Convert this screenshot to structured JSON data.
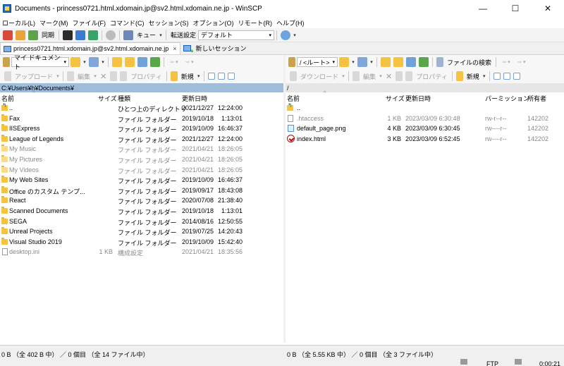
{
  "window": {
    "title": "Documents - princess0721.html.xdomain.jp@sv2.html.xdomain.ne.jp - WinSCP",
    "min_glyph": "—",
    "max_glyph": "☐",
    "close_glyph": "✕"
  },
  "menu": [
    "ローカル(L)",
    "マーク(M)",
    "ファイル(F)",
    "コマンド(C)",
    "セッション(S)",
    "オプション(O)",
    "リモート(R)",
    "ヘルプ(H)"
  ],
  "toolbar": {
    "sync_label": "同期",
    "queue_label": "キュー",
    "transfer_label": "転送設定",
    "transfer_value": "デフォルト"
  },
  "tabs": {
    "session_tab": "princess0721.html.xdomain.jp@sv2.html.xdomain.ne.jp",
    "close_glyph": "×",
    "new_session": "新しいセッション"
  },
  "left": {
    "location": "マイ ドキュメント",
    "upload": "アップロード",
    "edit": "編集",
    "properties": "プロパティ",
    "new": "新規",
    "path": "C:¥Users¥h¥Documents¥",
    "columns": {
      "name": "名前",
      "size": "サイズ",
      "type": "種類",
      "modified": "更新日時"
    },
    "rows": [
      {
        "name": "..",
        "size": "",
        "type": "ひとつ上のディレクトリ",
        "modified": "2021/12/27",
        "time": "12:24:00",
        "icon": "up",
        "grey": false
      },
      {
        "name": "Fax",
        "size": "",
        "type": "ファイル フォルダー",
        "modified": "2019/10/18",
        "time": "1:13:01",
        "icon": "folder",
        "grey": false
      },
      {
        "name": "IISExpress",
        "size": "",
        "type": "ファイル フォルダー",
        "modified": "2019/10/09",
        "time": "16:46:37",
        "icon": "folder",
        "grey": false
      },
      {
        "name": "League of Legends",
        "size": "",
        "type": "ファイル フォルダー",
        "modified": "2021/12/27",
        "time": "12:24:00",
        "icon": "folder",
        "grey": false
      },
      {
        "name": "My Music",
        "size": "",
        "type": "ファイル フォルダー",
        "modified": "2021/04/21",
        "time": "18:26:05",
        "icon": "folder",
        "grey": true
      },
      {
        "name": "My Pictures",
        "size": "",
        "type": "ファイル フォルダー",
        "modified": "2021/04/21",
        "time": "18:26:05",
        "icon": "folder",
        "grey": true
      },
      {
        "name": "My Videos",
        "size": "",
        "type": "ファイル フォルダー",
        "modified": "2021/04/21",
        "time": "18:26:05",
        "icon": "folder",
        "grey": true
      },
      {
        "name": "My Web Sites",
        "size": "",
        "type": "ファイル フォルダー",
        "modified": "2019/10/09",
        "time": "16:46:37",
        "icon": "folder",
        "grey": false
      },
      {
        "name": "Office のカスタム テンプ...",
        "size": "",
        "type": "ファイル フォルダー",
        "modified": "2019/09/17",
        "time": "18:43:08",
        "icon": "folder",
        "grey": false
      },
      {
        "name": "React",
        "size": "",
        "type": "ファイル フォルダー",
        "modified": "2020/07/08",
        "time": "21:38:40",
        "icon": "folder",
        "grey": false
      },
      {
        "name": "Scanned Documents",
        "size": "",
        "type": "ファイル フォルダー",
        "modified": "2019/10/18",
        "time": "1:13:01",
        "icon": "folder",
        "grey": false
      },
      {
        "name": "SEGA",
        "size": "",
        "type": "ファイル フォルダー",
        "modified": "2014/08/16",
        "time": "12:50:55",
        "icon": "folder",
        "grey": false
      },
      {
        "name": "Unreal Projects",
        "size": "",
        "type": "ファイル フォルダー",
        "modified": "2019/07/25",
        "time": "14:20:43",
        "icon": "folder",
        "grey": false
      },
      {
        "name": "Visual Studio 2019",
        "size": "",
        "type": "ファイル フォルダー",
        "modified": "2019/10/09",
        "time": "15:42:40",
        "icon": "folder",
        "grey": false
      },
      {
        "name": "desktop.ini",
        "size": "1 KB",
        "type": "構成設定",
        "modified": "2021/04/21",
        "time": "18:35:56",
        "icon": "file",
        "grey": true
      }
    ],
    "status": "0 B （全 402 B 中） ／ 0 個目 （全 14 ファイル中）"
  },
  "right": {
    "location": "/ <ルート>",
    "find": "ファイルの検索",
    "download": "ダウンロード",
    "edit": "編集",
    "properties": "プロパティ",
    "new": "新規",
    "path": "/",
    "columns": {
      "name": "名前",
      "size": "サイズ",
      "modified": "更新日時",
      "perm": "パーミッション",
      "owner": "所有者"
    },
    "rows": [
      {
        "name": "..",
        "size": "",
        "modified": "",
        "perm": "",
        "owner": "",
        "icon": "up",
        "grey": false
      },
      {
        "name": ".htaccess",
        "size": "1 KB",
        "modified": "2023/03/09 6:30:48",
        "perm": "rw-r--r--",
        "owner": "142202",
        "icon": "file",
        "grey": true
      },
      {
        "name": "default_page.png",
        "size": "4 KB",
        "modified": "2023/03/09 6:30:45",
        "perm": "rw----r--",
        "owner": "142202",
        "icon": "img",
        "grey": false
      },
      {
        "name": "index.html",
        "size": "3 KB",
        "modified": "2023/03/09 6:52:45",
        "perm": "rw----r--",
        "owner": "142202",
        "icon": "html",
        "grey": false
      }
    ],
    "status": "0 B （全 5.55 KB 中） ／ 0 個目 （全 3 ファイル中）"
  },
  "statusbar": {
    "protocol": "FTP",
    "elapsed": "0:00:21"
  },
  "colors": {
    "path_active": "#9fbcd9",
    "folder": "#f5c242",
    "html_icon": "#c40000"
  }
}
